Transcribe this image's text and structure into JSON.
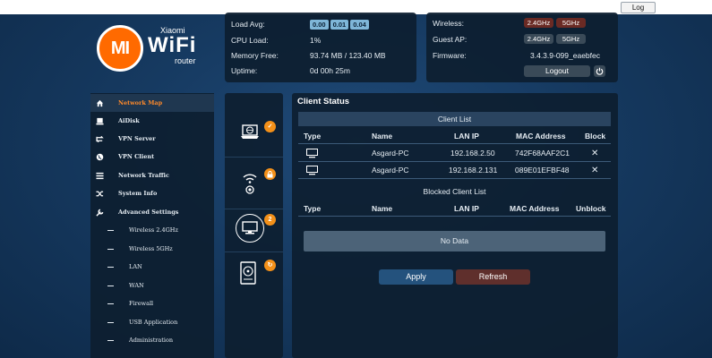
{
  "topbar": {
    "log_label": "Log"
  },
  "logo": {
    "mark": "MI",
    "line1": "Xiaomi",
    "line2": "WiFi",
    "line3": "router"
  },
  "status": {
    "load_avg_label": "Load Avg:",
    "load_avg_values": [
      "0.00",
      "0.01",
      "0.04"
    ],
    "cpu_label": "CPU Load:",
    "cpu_value": "1%",
    "memory_label": "Memory Free:",
    "memory_value": "93.74 MB / 123.40 MB",
    "uptime_label": "Uptime:",
    "uptime_value": "0d 00h 25m"
  },
  "router": {
    "wireless_label": "Wireless:",
    "wireless_24": "2.4GHz",
    "wireless_5": "5GHz",
    "guest_label": "Guest AP:",
    "guest_24": "2.4GHz",
    "guest_5": "5GHz",
    "firmware_label": "Firmware:",
    "firmware_value": "3.4.3.9-099_eaebfec",
    "logout_label": "Logout"
  },
  "menu": {
    "items": [
      {
        "label": "Network Map",
        "icon": "home-icon"
      },
      {
        "label": "AiDisk",
        "icon": "disk-icon"
      },
      {
        "label": "VPN Server",
        "icon": "vpn-server-icon"
      },
      {
        "label": "VPN Client",
        "icon": "globe-icon"
      },
      {
        "label": "Network Traffic",
        "icon": "traffic-icon"
      },
      {
        "label": "System Info",
        "icon": "shuffle-icon"
      },
      {
        "label": "Advanced Settings",
        "icon": "wrench-icon"
      }
    ],
    "subitems": [
      "Wireless 2.4GHz",
      "Wireless 5GHz",
      "LAN",
      "WAN",
      "Firewall",
      "USB Application",
      "Administration"
    ]
  },
  "side_icons": {
    "client_badge": "2",
    "colors": {
      "accent": "#f39019"
    }
  },
  "client_status": {
    "title": "Client Status",
    "client_list_title": "Client List",
    "headers": [
      "Type",
      "Name",
      "LAN IP",
      "MAC Address",
      "Block"
    ],
    "rows": [
      {
        "name": "Asgard-PC",
        "ip": "192.168.2.50",
        "mac": "742F68AAF2C1"
      },
      {
        "name": "Asgard-PC",
        "ip": "192.168.2.131",
        "mac": "089E01EFBF48"
      }
    ],
    "blocked_list_title": "Blocked Client List",
    "blocked_headers": [
      "Type",
      "Name",
      "LAN IP",
      "MAC Address",
      "Unblock"
    ],
    "no_data": "No Data",
    "apply_label": "Apply",
    "refresh_label": "Refresh"
  }
}
